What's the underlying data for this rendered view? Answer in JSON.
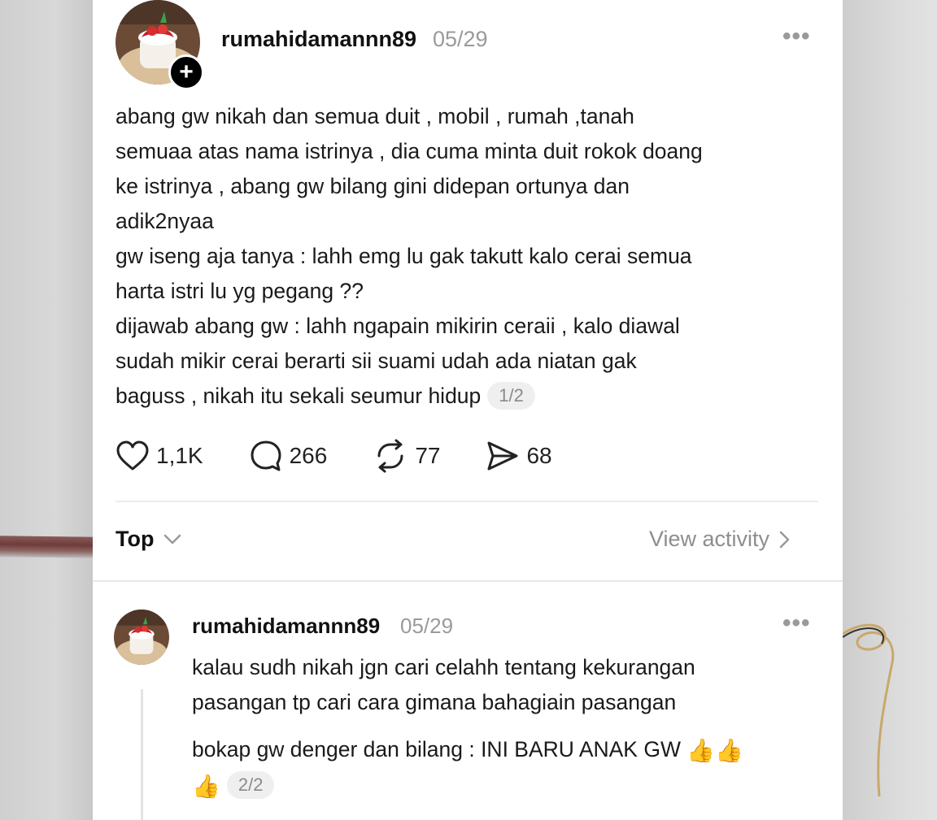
{
  "post": {
    "username": "rumahidamannn89",
    "date": "05/29",
    "follow_symbol": "+",
    "more_symbol": "•••",
    "lines": [
      "abang gw nikah dan semua duit , mobil , rumah ,tanah",
      "semuaa atas nama istrinya , dia cuma minta duit rokok doang",
      "ke istrinya , abang gw bilang gini didepan ortunya dan",
      "adik2nyaa",
      "gw iseng aja tanya : lahh emg lu gak takutt kalo cerai semua",
      "harta istri lu yg pegang ??",
      "dijawab abang gw : lahh ngapain mikirin ceraii , kalo diawal",
      "sudah mikir cerai berarti sii suami udah ada niatan gak",
      "baguss , nikah itu sekali seumur hidup"
    ],
    "page_indicator": "1/2",
    "likes": "1,1K",
    "replies": "266",
    "reposts": "77",
    "shares": "68"
  },
  "sort": {
    "label": "Top",
    "view_activity": "View activity"
  },
  "reply": {
    "username": "rumahidamannn89",
    "date": "05/29",
    "more_symbol": "•••",
    "lines": [
      "kalau sudh nikah jgn cari celahh tentang kekurangan",
      "pasangan tp cari cara gimana bahagiain pasangan"
    ],
    "line_3": "bokap gw denger dan bilang : INI BARU ANAK GW ",
    "emoji_a": "👍👍",
    "emoji_b": "👍",
    "page_indicator": "2/2"
  },
  "colors": {
    "card_bg": "#ffffff",
    "muted_text": "#9a9a9a",
    "pill_bg": "#efefef"
  },
  "icons": [
    "plus-icon",
    "more-icon",
    "heart-icon",
    "comment-icon",
    "repost-icon",
    "share-icon",
    "chevron-down-icon",
    "chevron-right-icon"
  ]
}
